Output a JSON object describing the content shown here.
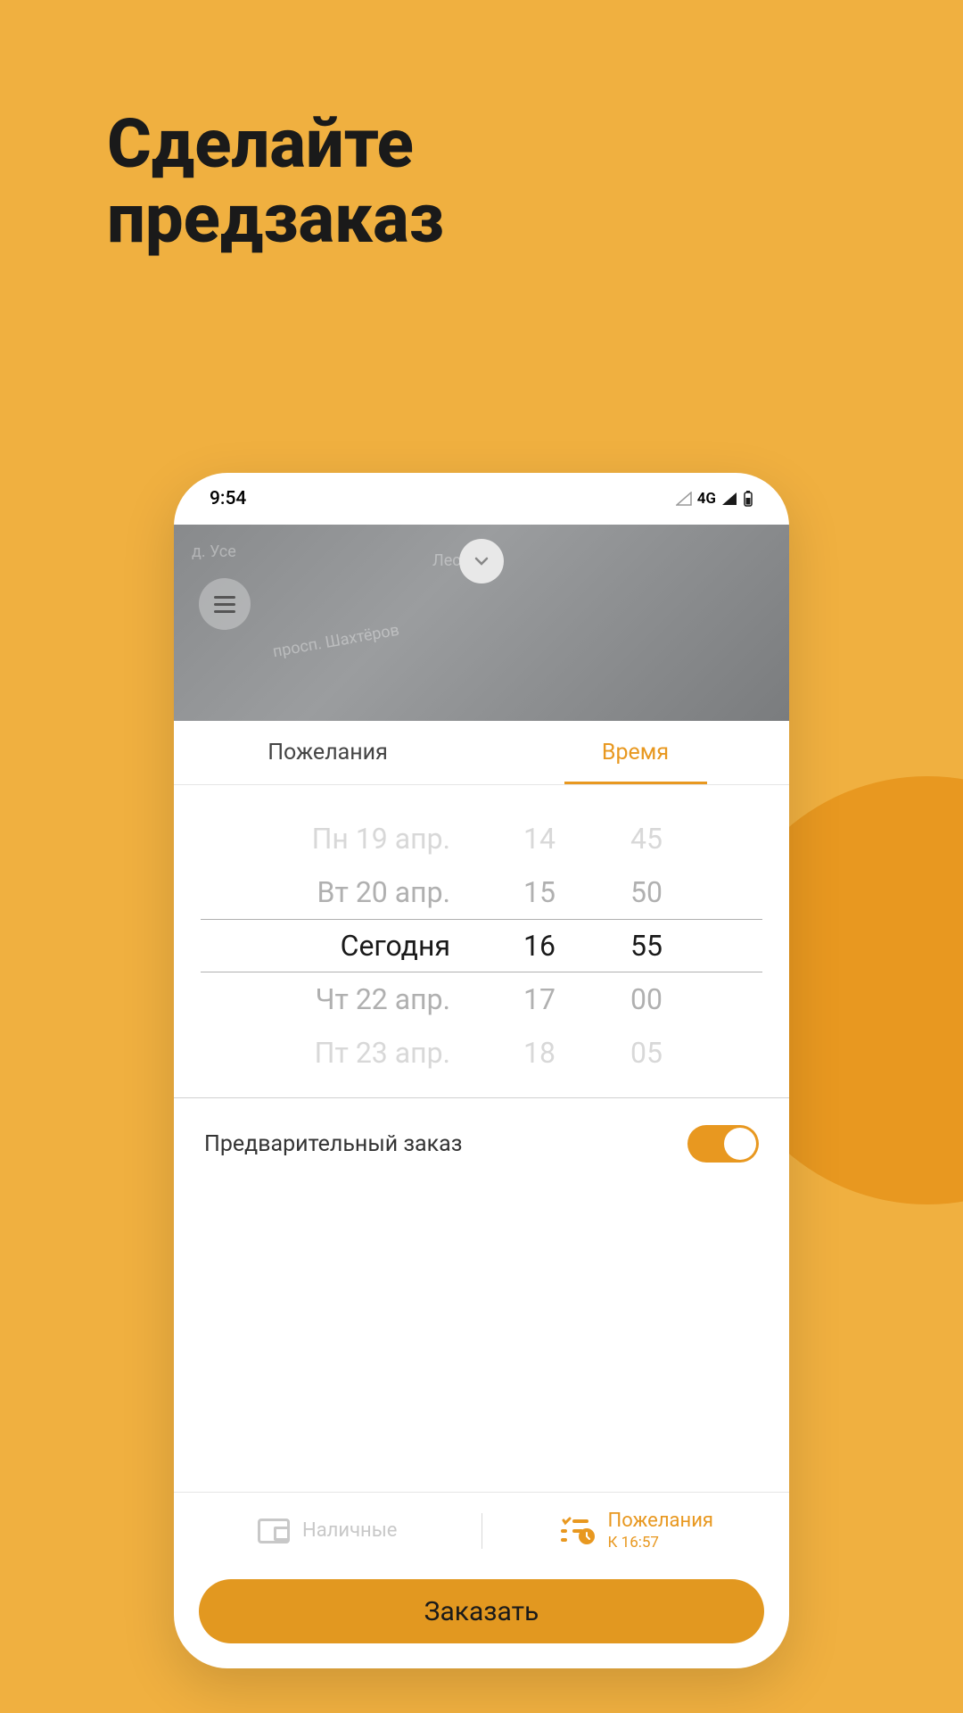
{
  "headline": {
    "line1": "Сделайте",
    "line2": "предзаказ"
  },
  "statusbar": {
    "time": "9:54",
    "network": "4G"
  },
  "map": {
    "label1": "д. Усе",
    "label2": "Лесотора",
    "label3": "просп. Шахтёров"
  },
  "tabs": {
    "tab1": "Пожелания",
    "tab2": "Время"
  },
  "picker": {
    "rows": [
      {
        "date": "Пн 19 апр.",
        "hour": "14",
        "min": "45"
      },
      {
        "date": "Вт 20 апр.",
        "hour": "15",
        "min": "50"
      },
      {
        "date": "Сегодня",
        "hour": "16",
        "min": "55"
      },
      {
        "date": "Чт 22 апр.",
        "hour": "17",
        "min": "00"
      },
      {
        "date": "Пт 23 апр.",
        "hour": "18",
        "min": "05"
      }
    ]
  },
  "toggle": {
    "label": "Предварительный заказ",
    "on": true
  },
  "bottom": {
    "payment": "Наличные",
    "wishes": "Пожелания",
    "wishes_sub": "К 16:57",
    "order": "Заказать"
  }
}
